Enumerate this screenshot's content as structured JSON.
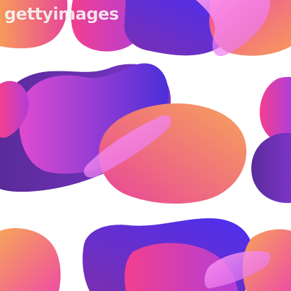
{
  "watermark": {
    "text": "gettyimages",
    "kind": "stock-photo-logo"
  },
  "artwork": {
    "description_kind": "seamless abstract fluid blob pattern",
    "background": "#ffffff",
    "palette": {
      "orange": "#f79a5a",
      "coral": "#f26a6a",
      "pink": "#e8459a",
      "magenta": "#c53fd9",
      "violet": "#8c3fd6",
      "indigo": "#4a2fd8",
      "deep_purple": "#5a2b9a",
      "light_pink": "#ff8ff0"
    }
  }
}
